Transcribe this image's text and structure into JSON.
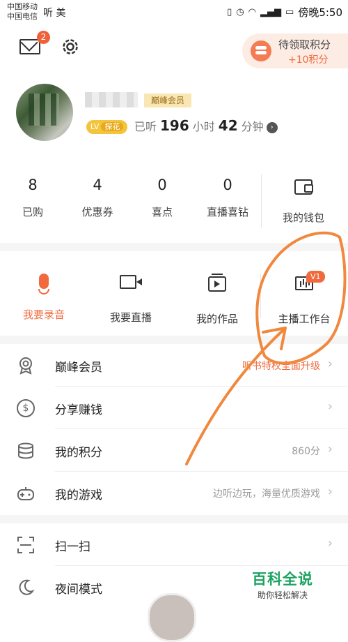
{
  "status_bar": {
    "carrier_1": "中国移动",
    "carrier_2": "中国电信",
    "left_extra": "听 美",
    "time": "傍晚5:50"
  },
  "header": {
    "message_badge": "2",
    "points_pill": {
      "title": "待领取积分",
      "sub": "+10积分"
    }
  },
  "profile": {
    "vip_tag": "巅峰会员",
    "level_tag": "LV",
    "level_name": "探花",
    "listened_prefix": "已听",
    "hours": "196",
    "hours_unit": "小时",
    "minutes": "42",
    "minutes_unit": "分钟"
  },
  "stats": [
    {
      "value": "8",
      "label": "已购"
    },
    {
      "value": "4",
      "label": "优惠券"
    },
    {
      "value": "0",
      "label": "喜点"
    },
    {
      "value": "0",
      "label": "直播喜钻"
    }
  ],
  "wallet_label": "我的钱包",
  "tools": [
    {
      "label": "我要录音"
    },
    {
      "label": "我要直播"
    },
    {
      "label": "我的作品"
    },
    {
      "label": "主播工作台",
      "badge": "V1"
    }
  ],
  "menu_1": [
    {
      "title": "巅峰会员",
      "right": "听书特权全面升级"
    },
    {
      "title": "分享赚钱",
      "right": ""
    },
    {
      "title": "我的积分",
      "right": "860分"
    },
    {
      "title": "我的游戏",
      "right": "边听边玩，海量优质游戏"
    }
  ],
  "menu_2": [
    {
      "title": "扫一扫"
    },
    {
      "title": "夜间模式"
    }
  ],
  "watermark": {
    "title": "百科全说",
    "sub": "助你轻松解决"
  },
  "colors": {
    "accent": "#f06a3e",
    "annotation": "#f0883e",
    "vip_bg": "#f8e6b3"
  }
}
